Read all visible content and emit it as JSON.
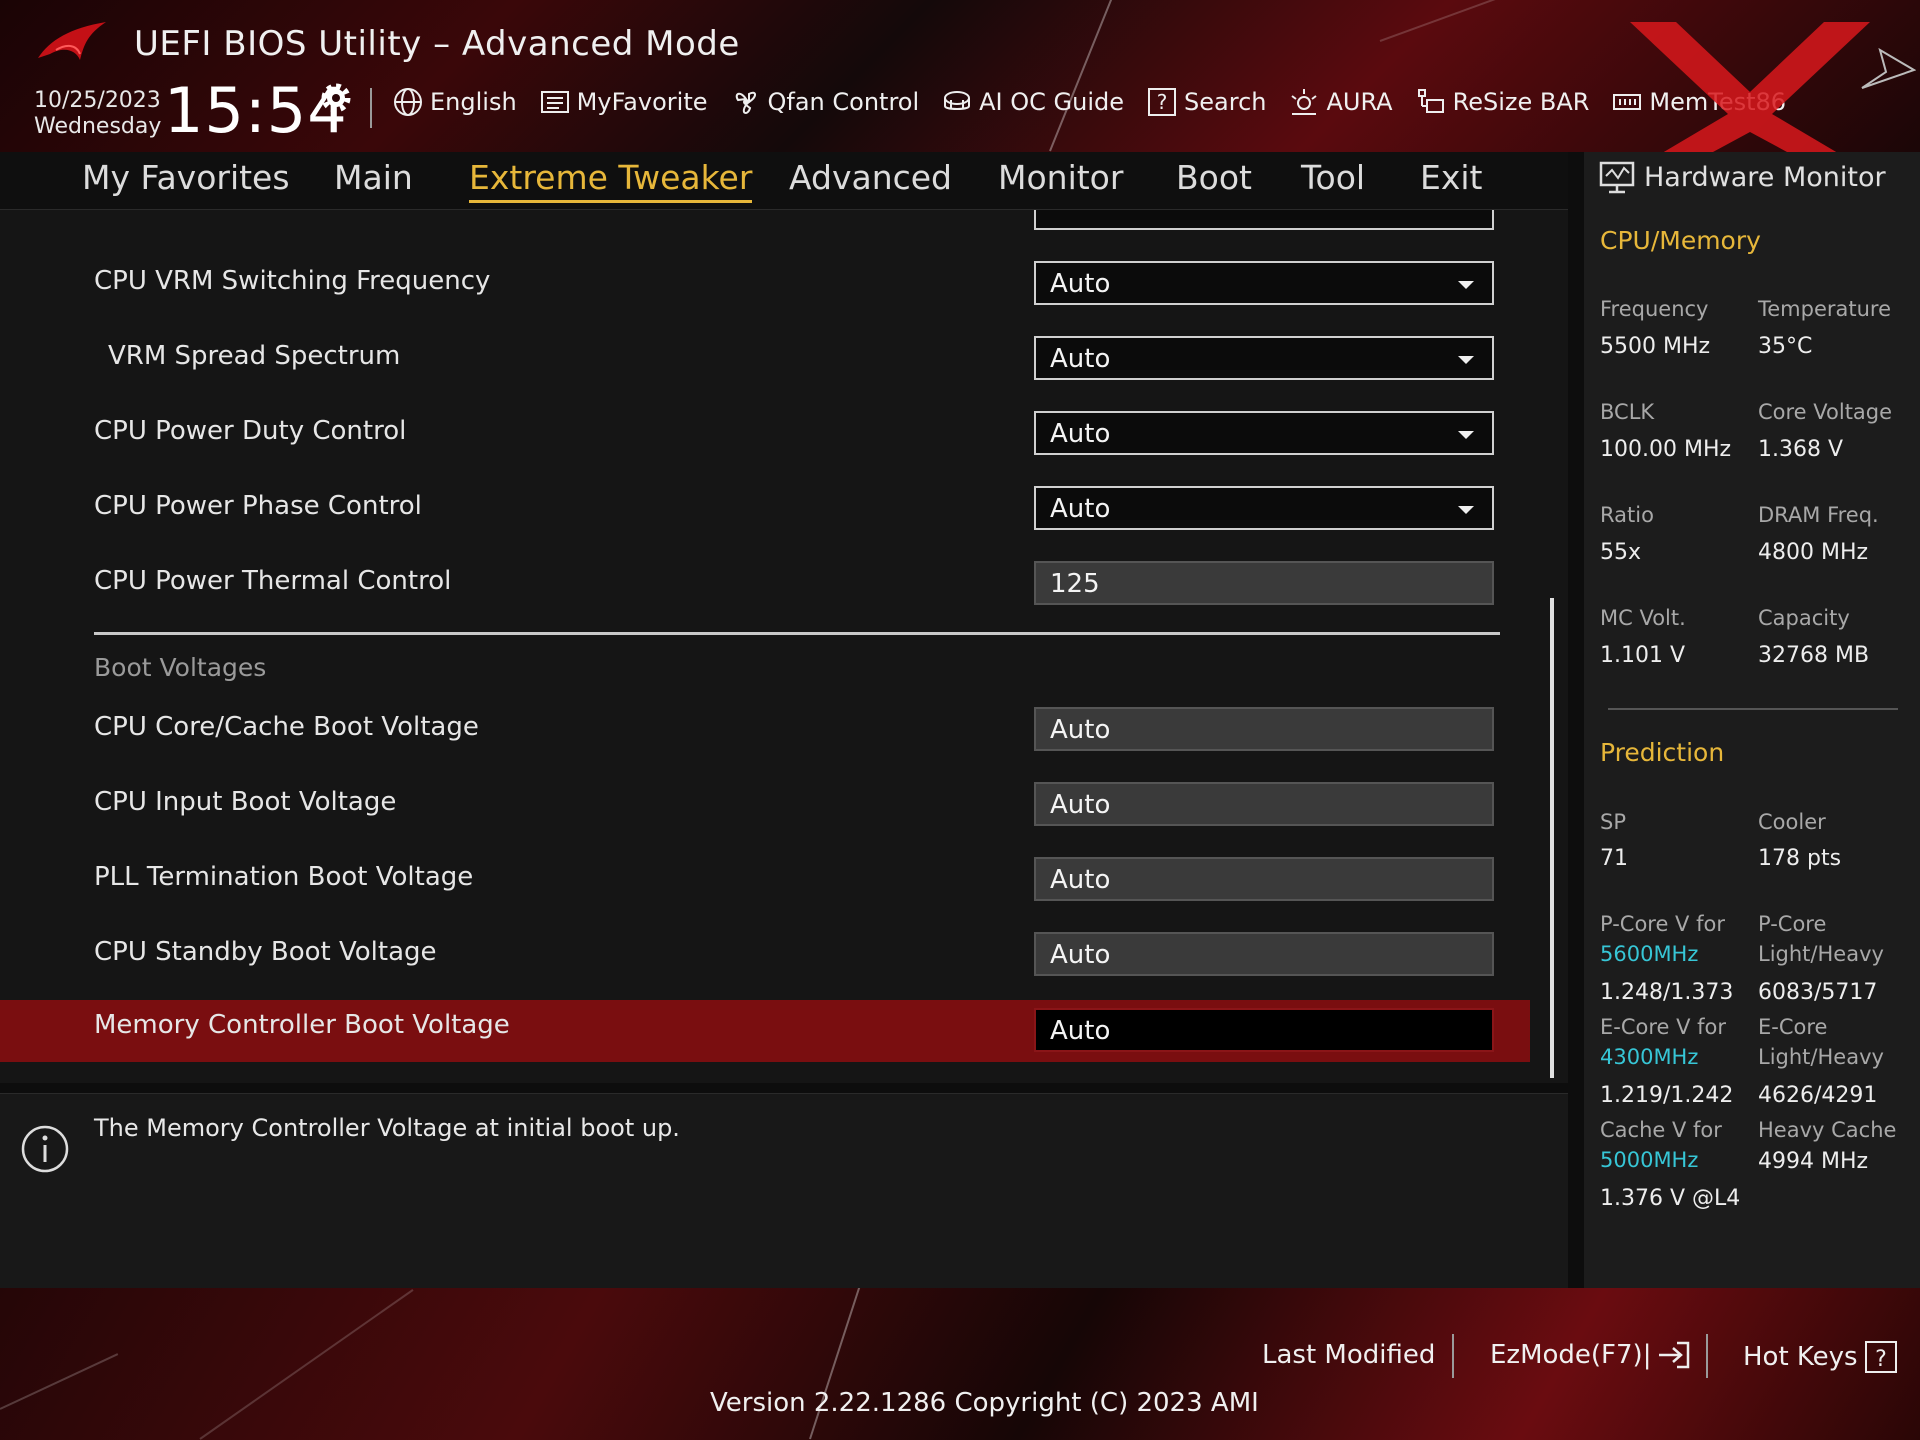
{
  "header": {
    "title": "UEFI BIOS Utility – Advanced Mode",
    "date": "10/25/2023",
    "weekday": "Wednesday",
    "time": "15:54",
    "tools": [
      {
        "label": "English",
        "icon": "globe-icon"
      },
      {
        "label": "MyFavorite",
        "icon": "favorite-list-icon"
      },
      {
        "label": "Qfan Control",
        "icon": "fan-icon"
      },
      {
        "label": "AI OC Guide",
        "icon": "ai-chip-icon"
      },
      {
        "label": "Search",
        "icon": "search-question-icon"
      },
      {
        "label": "AURA",
        "icon": "aura-light-icon"
      },
      {
        "label": "ReSize BAR",
        "icon": "resize-bar-icon"
      },
      {
        "label": "MemTest86",
        "icon": "memory-icon"
      }
    ]
  },
  "nav": {
    "tabs": [
      "My Favorites",
      "Main",
      "Extreme Tweaker",
      "Advanced",
      "Monitor",
      "Boot",
      "Tool",
      "Exit"
    ],
    "active": "Extreme Tweaker"
  },
  "settings": [
    {
      "label": "CPU VRM Switching Frequency",
      "value": "Auto",
      "type": "select"
    },
    {
      "label": "VRM Spread Spectrum",
      "value": "Auto",
      "type": "select"
    },
    {
      "label": "CPU Power Duty Control",
      "value": "Auto",
      "type": "select"
    },
    {
      "label": "CPU Power Phase Control",
      "value": "Auto",
      "type": "select"
    },
    {
      "label": "CPU Power Thermal Control",
      "value": "125",
      "type": "input"
    }
  ],
  "boot_section": {
    "heading": "Boot Voltages",
    "items": [
      {
        "label": "CPU Core/Cache Boot Voltage",
        "value": "Auto"
      },
      {
        "label": "CPU Input Boot Voltage",
        "value": "Auto"
      },
      {
        "label": "PLL Termination Boot Voltage",
        "value": "Auto"
      },
      {
        "label": "CPU Standby Boot Voltage",
        "value": "Auto"
      },
      {
        "label": "Memory Controller Boot Voltage",
        "value": "Auto",
        "selected": true
      }
    ]
  },
  "help_text": "The Memory Controller Voltage at initial boot up.",
  "hw_monitor": {
    "title": "Hardware Monitor",
    "cpu_memory": {
      "heading": "CPU/Memory",
      "frequency_label": "Frequency",
      "frequency": "5500 MHz",
      "temperature_label": "Temperature",
      "temperature": "35°C",
      "bclk_label": "BCLK",
      "bclk": "100.00 MHz",
      "core_voltage_label": "Core Voltage",
      "core_voltage": "1.368 V",
      "ratio_label": "Ratio",
      "ratio": "55x",
      "dram_label": "DRAM Freq.",
      "dram": "4800 MHz",
      "mc_volt_label": "MC Volt.",
      "mc_volt": "1.101 V",
      "capacity_label": "Capacity",
      "capacity": "32768 MB"
    },
    "prediction": {
      "heading": "Prediction",
      "sp_label": "SP",
      "sp": "71",
      "cooler_label": "Cooler",
      "cooler": "178 pts",
      "pcore_v_label": "P-Core V for",
      "pcore_v_freq": "5600MHz",
      "pcore_v": "1.248/1.373",
      "pcore_lh_label_1": "P-Core",
      "pcore_lh_label_2": "Light/Heavy",
      "pcore_lh": "6083/5717",
      "ecore_v_label": "E-Core V for",
      "ecore_v_freq": "4300MHz",
      "ecore_v": "1.219/1.242",
      "ecore_lh_label_1": "E-Core",
      "ecore_lh_label_2": "Light/Heavy",
      "ecore_lh": "4626/4291",
      "cache_v_label": "Cache V for",
      "cache_v_freq": "5000MHz",
      "cache_v": "1.376 V @L4",
      "heavy_cache_label": "Heavy Cache",
      "heavy_cache": "4994 MHz"
    }
  },
  "footer": {
    "last_modified": "Last Modified",
    "ezmode": "EzMode(F7)|",
    "hotkeys": "Hot Keys",
    "version": "Version 2.22.1286 Copyright (C) 2023 AMI"
  },
  "colors": {
    "accent": "#e7b73a",
    "selection": "#7a0e10",
    "cyan": "#37c6d6",
    "brand_red": "#c41016"
  }
}
